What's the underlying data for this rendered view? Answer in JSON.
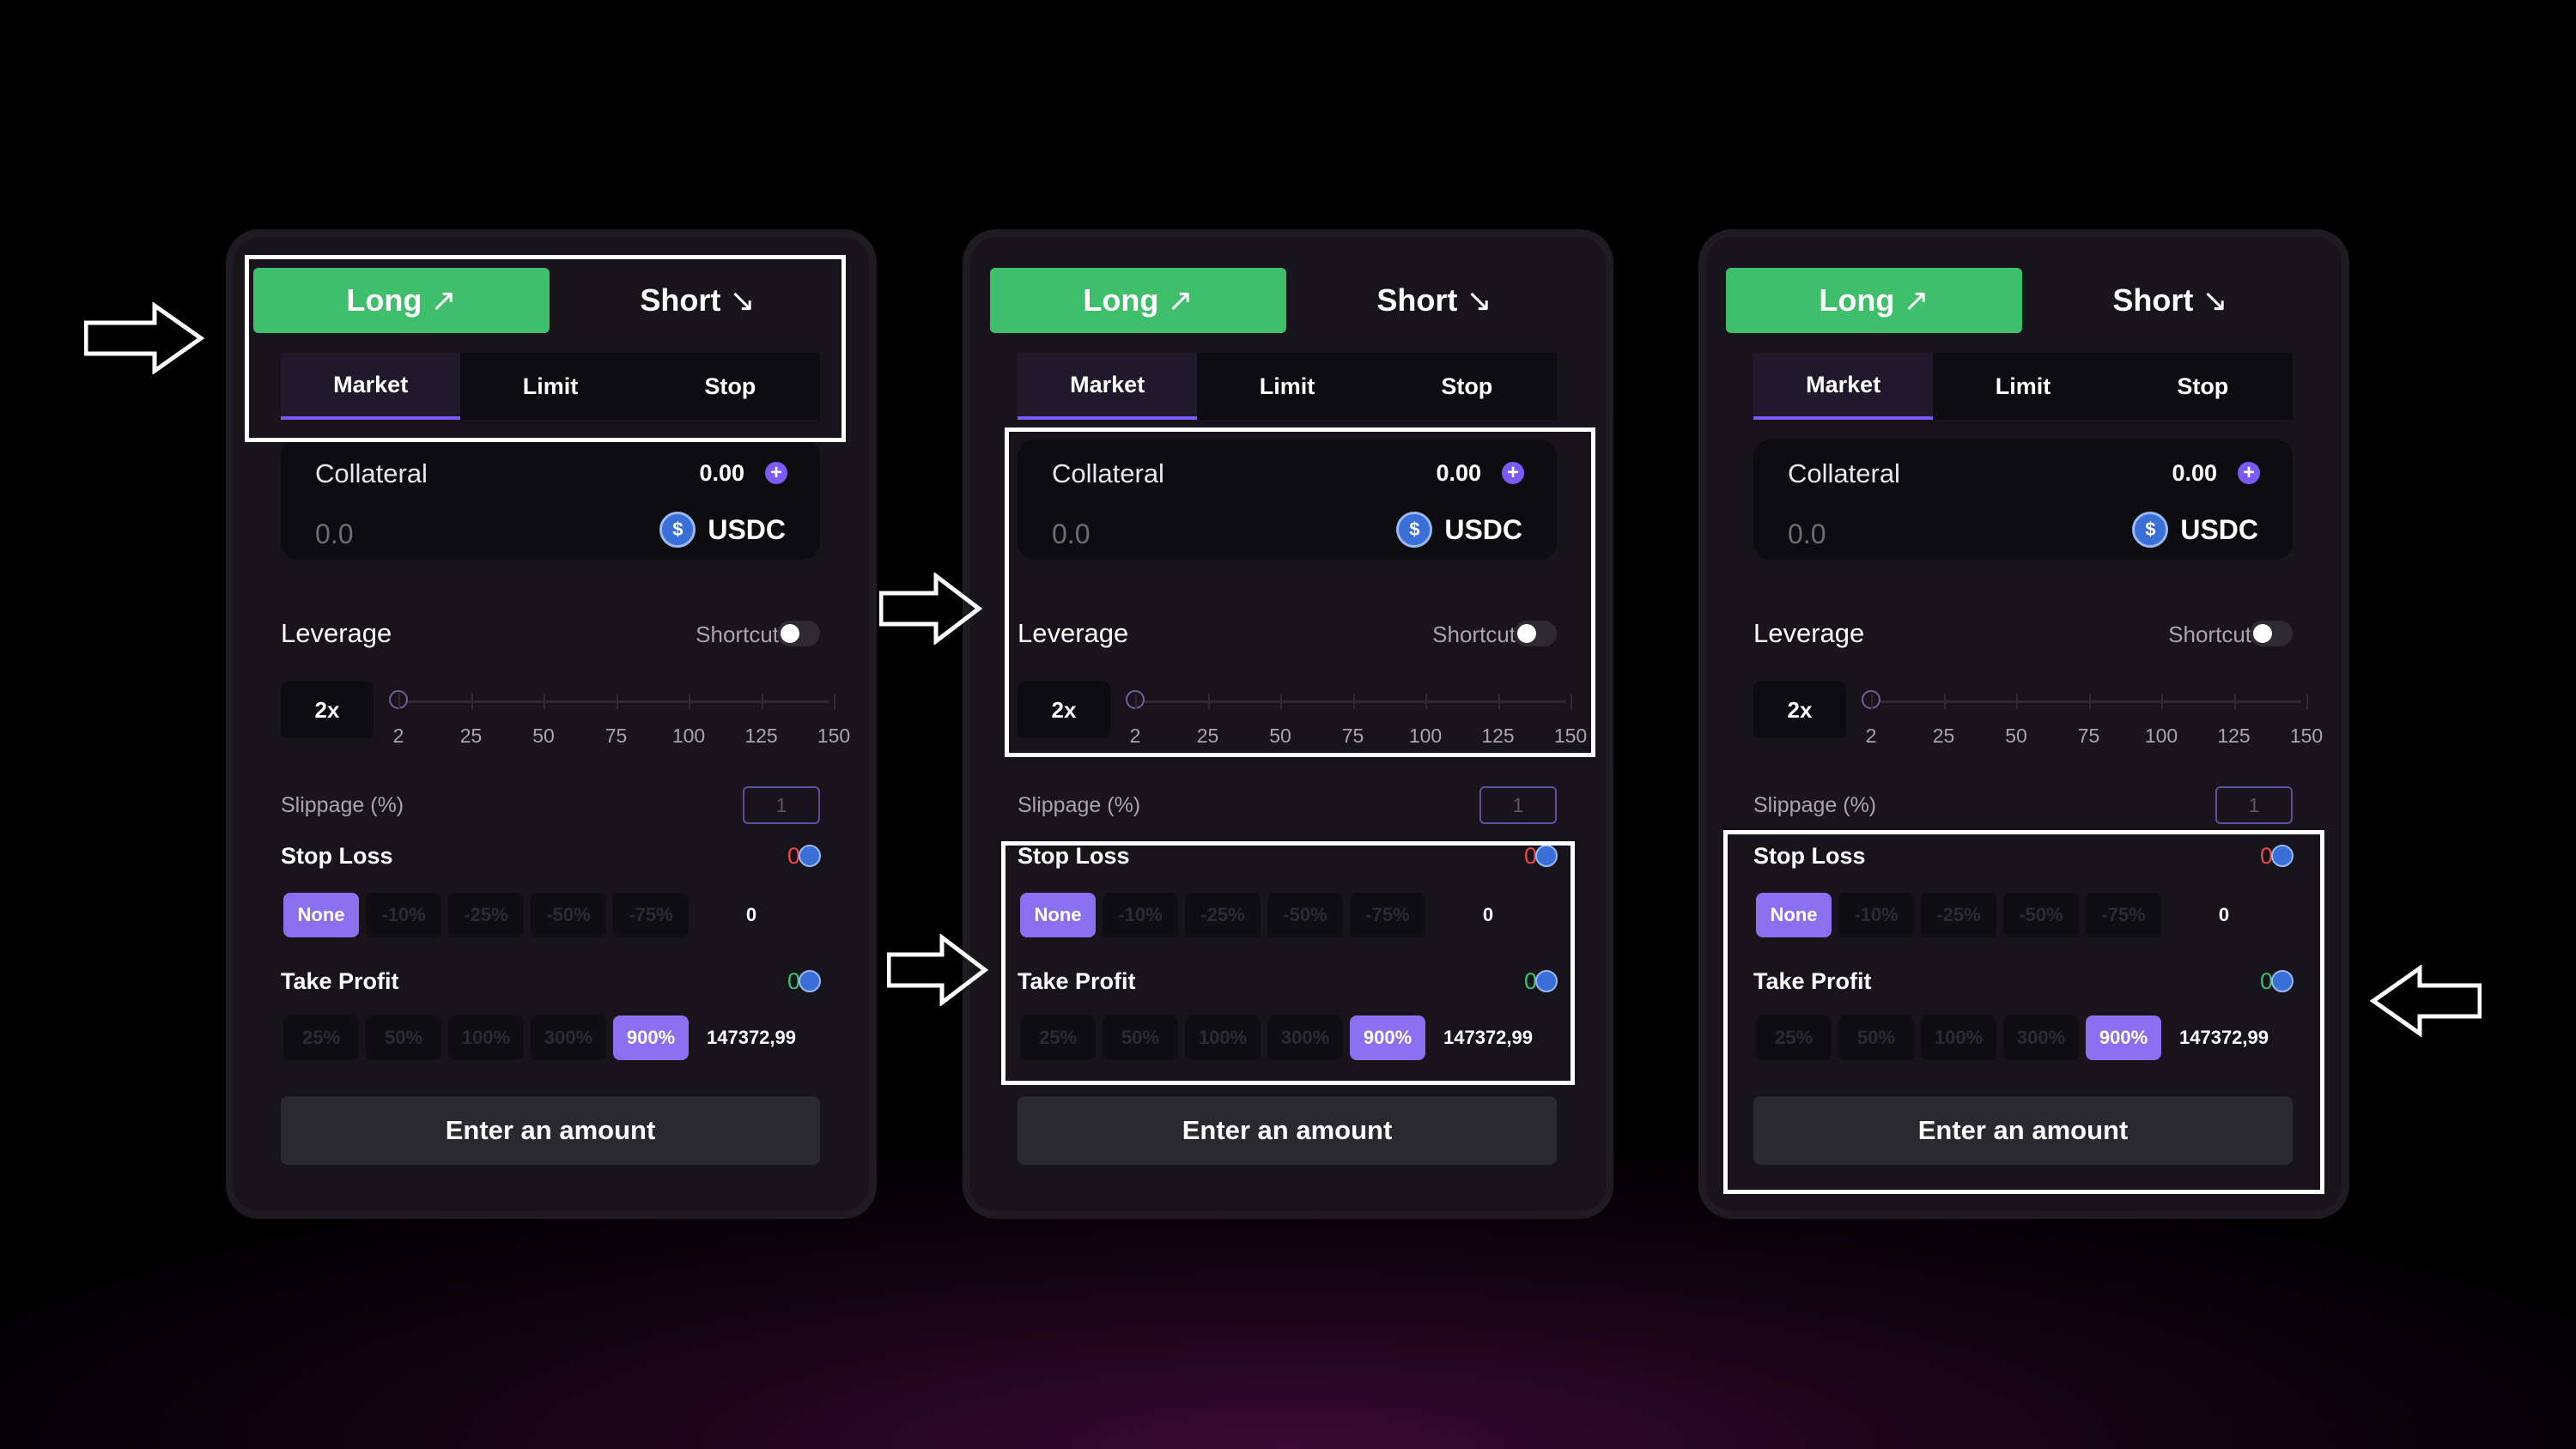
{
  "panels": [
    {
      "position_tabs": {
        "long": "Long",
        "short": "Short",
        "long_arrow": "↗",
        "short_arrow": "↘"
      },
      "order_tabs": [
        "Market",
        "Limit",
        "Stop"
      ],
      "collateral": {
        "label": "Collateral",
        "balance": "0.00",
        "input_placeholder": "0.0",
        "token": "USDC"
      },
      "leverage": {
        "label": "Leverage",
        "shortcut": "Shortcut",
        "value": "2x",
        "ticks": [
          "2",
          "25",
          "50",
          "75",
          "100",
          "125",
          "150"
        ]
      },
      "slippage": {
        "label": "Slippage (%)",
        "placeholder": "1"
      },
      "stop_loss": {
        "label": "Stop Loss",
        "value": "0",
        "options": [
          "None",
          "-10%",
          "-25%",
          "-50%",
          "-75%"
        ],
        "selected": "None",
        "amount": "0"
      },
      "take_profit": {
        "label": "Take Profit",
        "value": "0",
        "options": [
          "25%",
          "50%",
          "100%",
          "300%",
          "900%"
        ],
        "selected": "900%",
        "amount": "147372,99"
      },
      "submit": "Enter an amount"
    },
    {
      "position_tabs": {
        "long": "Long",
        "short": "Short",
        "long_arrow": "↗",
        "short_arrow": "↘"
      },
      "order_tabs": [
        "Market",
        "Limit",
        "Stop"
      ],
      "collateral": {
        "label": "Collateral",
        "balance": "0.00",
        "input_placeholder": "0.0",
        "token": "USDC"
      },
      "leverage": {
        "label": "Leverage",
        "shortcut": "Shortcut",
        "value": "2x",
        "ticks": [
          "2",
          "25",
          "50",
          "75",
          "100",
          "125",
          "150"
        ]
      },
      "slippage": {
        "label": "Slippage (%)",
        "placeholder": "1"
      },
      "stop_loss": {
        "label": "Stop Loss",
        "value": "0",
        "options": [
          "None",
          "-10%",
          "-25%",
          "-50%",
          "-75%"
        ],
        "selected": "None",
        "amount": "0"
      },
      "take_profit": {
        "label": "Take Profit",
        "value": "0",
        "options": [
          "25%",
          "50%",
          "100%",
          "300%",
          "900%"
        ],
        "selected": "900%",
        "amount": "147372,99"
      },
      "submit": "Enter an amount"
    },
    {
      "position_tabs": {
        "long": "Long",
        "short": "Short",
        "long_arrow": "↗",
        "short_arrow": "↘"
      },
      "order_tabs": [
        "Market",
        "Limit",
        "Stop"
      ],
      "collateral": {
        "label": "Collateral",
        "balance": "0.00",
        "input_placeholder": "0.0",
        "token": "USDC"
      },
      "leverage": {
        "label": "Leverage",
        "shortcut": "Shortcut",
        "value": "2x",
        "ticks": [
          "2",
          "25",
          "50",
          "75",
          "100",
          "125",
          "150"
        ]
      },
      "slippage": {
        "label": "Slippage (%)",
        "placeholder": "1"
      },
      "stop_loss": {
        "label": "Stop Loss",
        "value": "0",
        "options": [
          "None",
          "-10%",
          "-25%",
          "-50%",
          "-75%"
        ],
        "selected": "None",
        "amount": "0"
      },
      "take_profit": {
        "label": "Take Profit",
        "value": "0",
        "options": [
          "25%",
          "50%",
          "100%",
          "300%",
          "900%"
        ],
        "selected": "900%",
        "amount": "147372,99"
      },
      "submit": "Enter an amount"
    }
  ],
  "colors": {
    "long": "#3fbe6b",
    "accent": "#7a5af8",
    "loss": "#e94a4a",
    "chip_active": "#8a70ee"
  },
  "icons": [
    "usdc-icon",
    "plus-icon",
    "right-arrow-icon",
    "left-arrow-icon"
  ]
}
